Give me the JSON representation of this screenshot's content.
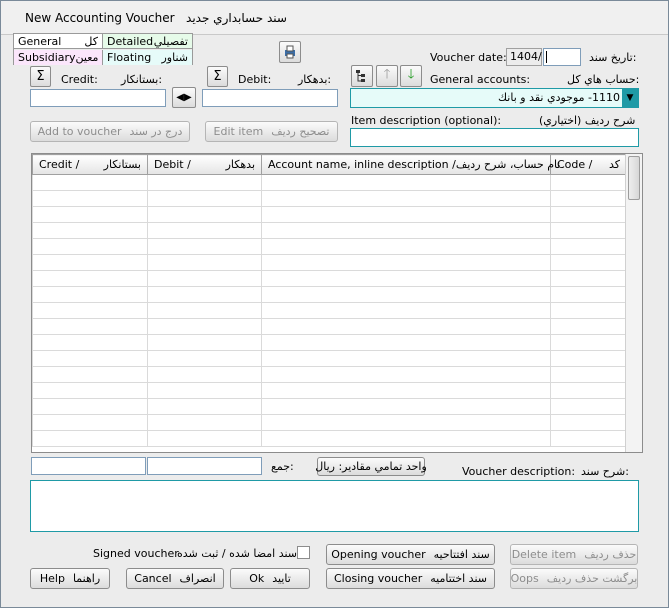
{
  "window": {
    "title_en": "New Accounting Voucher",
    "title_fa": "سند حسابداري جديد"
  },
  "legend": {
    "general": {
      "en": "General",
      "fa": "كل",
      "color": "#ffffff"
    },
    "detailed": {
      "en": "Detailed",
      "fa": "تفصيلي",
      "color": "#e6fbe9"
    },
    "subsidiary": {
      "en": "Subsidiary",
      "fa": "معين",
      "color": "#fbe6fb"
    },
    "floating": {
      "en": "Floating",
      "fa": "شناور",
      "color": "#e6fbf9"
    }
  },
  "header": {
    "voucher_date_en": "Voucher date:",
    "voucher_date_fa": "تاريخ سند:",
    "voucher_year": "1404/",
    "voucher_date_value": "",
    "general_accounts_en": "General accounts:",
    "general_accounts_fa": "حساب هاي كل:",
    "general_account_value": "1110- موجودي نقد و بانك",
    "item_desc_en": "Item description (optional):",
    "item_desc_fa": "شرح رديف (اختياري)",
    "item_desc_value": ""
  },
  "amounts": {
    "credit_en": "Credit:",
    "credit_fa": "بستانكار:",
    "credit_value": "",
    "debit_en": "Debit:",
    "debit_fa": "بدهكار:",
    "debit_value": "",
    "sigma": "Σ",
    "swap": "◀▶"
  },
  "buttons": {
    "add_to_voucher_en": "Add to voucher",
    "add_to_voucher_fa": "درج در سند",
    "edit_item_en": "Edit item",
    "edit_item_fa": "تصحيح رديف",
    "opening_voucher_en": "Opening voucher",
    "opening_voucher_fa": "سند افتتاحيه",
    "closing_voucher_en": "Closing voucher",
    "closing_voucher_fa": "سند اختتاميه",
    "delete_item_en": "Delete item",
    "delete_item_fa": "حذف رديف",
    "oops_en": "Oops",
    "oops_fa": "برگشت حذف رديف",
    "help_en": "Help",
    "help_fa": "راهنما",
    "cancel_en": "Cancel",
    "cancel_fa": "انصراف",
    "ok_en": "Ok",
    "ok_fa": "تاييد",
    "currency_unit": "واحد تمامي مقادير: ريال"
  },
  "grid": {
    "columns": [
      {
        "en": "Credit /",
        "fa": "بستانكار"
      },
      {
        "en": "Debit /",
        "fa": "بدهكار"
      },
      {
        "en": "Account name, inline description /",
        "fa": "نام حساب، شرح رديف"
      },
      {
        "en": "Code /",
        "fa": "كد"
      }
    ]
  },
  "totals": {
    "label_fa": "جمع:",
    "credit_total": "",
    "debit_total": ""
  },
  "footer": {
    "voucher_desc_en": "Voucher description:",
    "voucher_desc_fa": "شرح سند:",
    "voucher_desc_value": "",
    "signed_en": "Signed voucher",
    "signed_fa": "سند امضا شده / ثبت شده",
    "signed_checked": false
  },
  "icons": [
    "print-icon",
    "sigma-icon",
    "swap-icon",
    "tree-icon",
    "arrow-up-icon",
    "arrow-down-icon",
    "dropdown-arrow-icon"
  ]
}
